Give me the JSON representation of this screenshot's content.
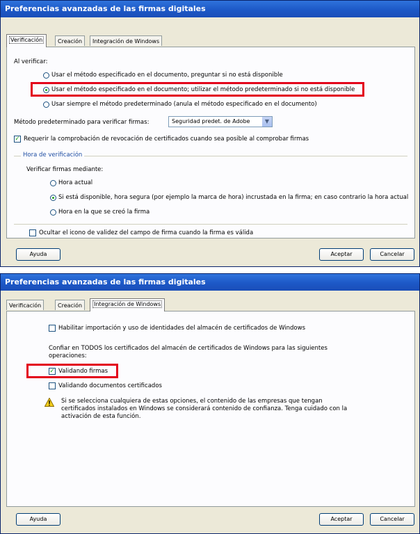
{
  "dialog1": {
    "title": "Preferencias avanzadas de las firmas digitales",
    "tabs": [
      "Verificación",
      "Creación",
      "Integración de Windows"
    ],
    "al_verificar": "Al verificar:",
    "radio1": "Usar el método especificado en el documento, preguntar si no está disponible",
    "radio2": "Usar el método especificado en el documento; utilizar el método predeterminado si no está disponible",
    "radio3": "Usar siempre el método predeterminado (anula el método especificado en el documento)",
    "metodo_label": "Método predeterminado para verificar firmas:",
    "metodo_value": "Seguridad predet. de Adobe",
    "revocacion": "Requerir la comprobación de revocación de certificados cuando sea posible al comprobar firmas",
    "hora_group": "Hora de verificación",
    "verificar_firmas": "Verificar firmas mediante:",
    "hora1": "Hora actual",
    "hora2": "Si está disponible, hora segura (por ejemplo la marca de hora) incrustada en la firma; en caso contrario la hora actual",
    "hora3": "Hora en la que se creó la firma",
    "ocultar": "Ocultar el icono de validez del campo de firma cuando la firma es válida",
    "ayuda": "Ayuda",
    "aceptar": "Aceptar",
    "cancelar": "Cancelar"
  },
  "dialog2": {
    "title": "Preferencias avanzadas de las firmas digitales",
    "tabs": [
      "Verificación",
      "Creación",
      "Integración de Windows"
    ],
    "habilitar": "Habilitar importación y uso de identidades del almacén de certificados de Windows",
    "confiar_1": "Confiar en TODOS los certificados del almacén de certificados de Windows para las siguientes",
    "confiar_2": "operaciones:",
    "validando_firmas": "Validando firmas",
    "validando_docs": "Validando documentos certificados",
    "warning_1": "Si se selecciona cualquiera de estas opciones, el contenido de las empresas que tengan",
    "warning_2": "certificados instalados en Windows se considerará contenido de confianza. Tenga cuidado con la",
    "warning_3": "activación de esta función.",
    "ayuda": "Ayuda",
    "aceptar": "Aceptar",
    "cancelar": "Cancelar"
  }
}
